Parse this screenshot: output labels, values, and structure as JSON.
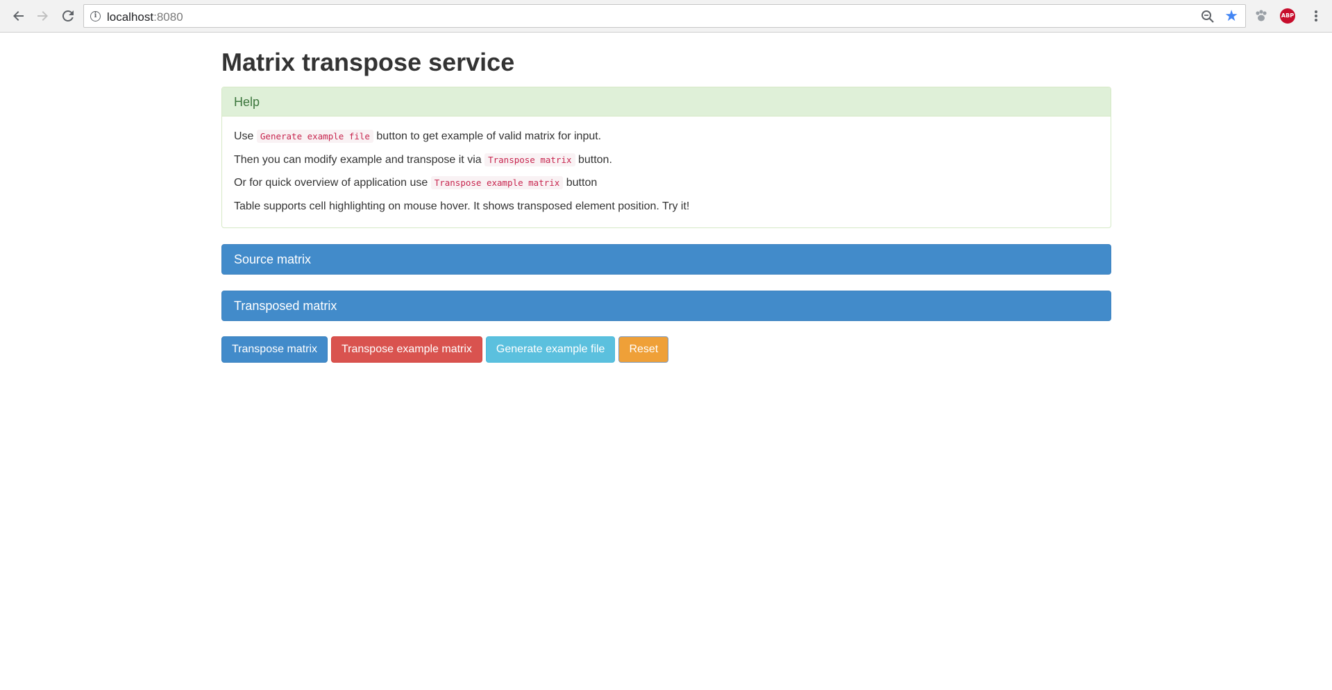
{
  "browser": {
    "url_host": "localhost",
    "url_port": ":8080",
    "abp_label": "ABP"
  },
  "page": {
    "title": "Matrix transpose service",
    "help": {
      "heading": "Help",
      "line1": {
        "pre": "Use ",
        "code": "Generate example file",
        "post": " button to get example of valid matrix for input."
      },
      "line2": {
        "pre": "Then you can modify example and transpose it via ",
        "code": "Transpose matrix",
        "post": " button."
      },
      "line3": {
        "pre": "Or for quick overview of application use ",
        "code": "Transpose example matrix",
        "post": " button"
      },
      "line4": "Table supports cell highlighting on mouse hover. It shows transposed element position. Try it!"
    },
    "source_panel": "Source matrix",
    "transposed_panel": "Transposed matrix",
    "buttons": {
      "transpose": "Transpose matrix",
      "transpose_example": "Transpose example matrix",
      "generate_example": "Generate example file",
      "reset": "Reset"
    }
  }
}
